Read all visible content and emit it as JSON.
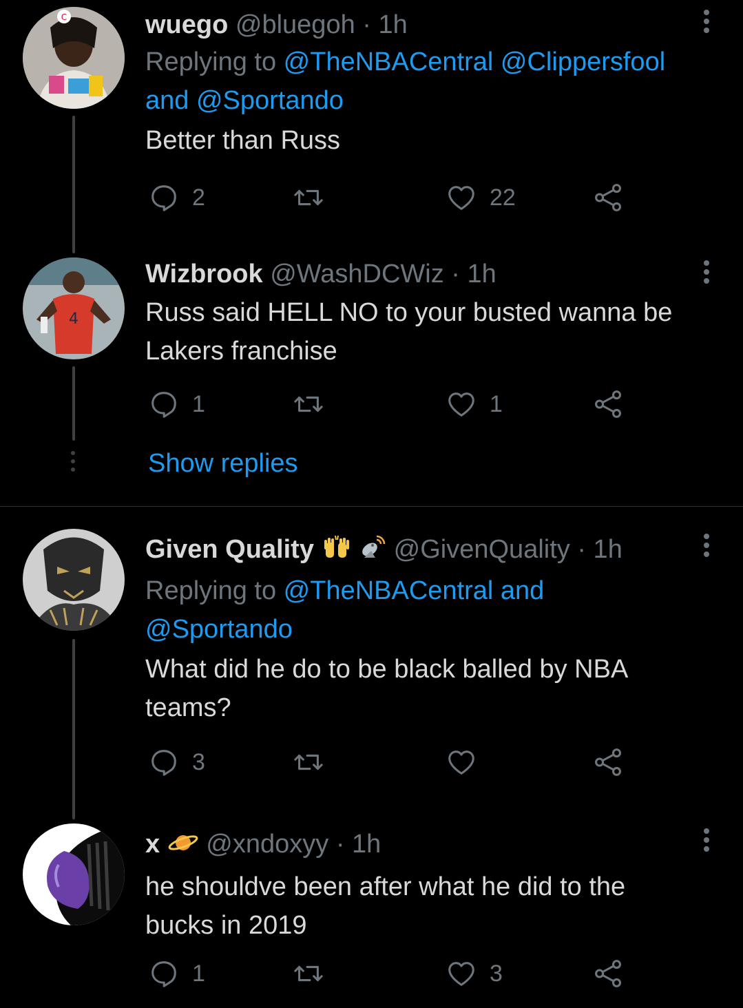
{
  "tweets": [
    {
      "name": "wuego",
      "handle": "@bluegoh",
      "time": "· 1h",
      "replying_prefix": "Replying to ",
      "replying_line1": "@TheNBACentral @Clippersfool",
      "replying_line2_and": "and ",
      "replying_line2_handle": "@Sportando",
      "text": "Better than Russ",
      "replies": "2",
      "retweets": "",
      "likes": "22"
    },
    {
      "name": "Wizbrook",
      "handle": "@WashDCWiz",
      "time": "· 1h",
      "text_line1": "Russ said HELL NO to your busted wanna be",
      "text_line2": "Lakers franchise",
      "replies": "1",
      "retweets": "",
      "likes": "1"
    },
    {
      "name": "Given Quality",
      "name_emojis": [
        "raising-hands-emoji",
        "satellite-dish-emoji"
      ],
      "handle": "@GivenQuality",
      "time": "· 1h",
      "replying_prefix": "Replying to ",
      "replying_line1": "@TheNBACentral and",
      "replying_line2_handle": "@Sportando",
      "text_line1": "What did he do to be black balled by NBA",
      "text_line2": "teams?",
      "replies": "3",
      "retweets": "",
      "likes": ""
    },
    {
      "name": "x",
      "name_emojis": [
        "ringed-planet-emoji"
      ],
      "handle": "@xndoxyy",
      "time": "· 1h",
      "text_line1": "he shouldve been after what he did to the",
      "text_line2": "bucks in 2019",
      "replies": "1",
      "retweets": "",
      "likes": "3"
    }
  ],
  "show_replies": "Show replies",
  "colors": {
    "background": "#000000",
    "text": "#d9d9d9",
    "secondary": "#6e767d",
    "link": "#1d9bf0",
    "thread_line": "#3e4144"
  },
  "icons": [
    "reply-icon",
    "retweet-icon",
    "like-icon",
    "share-icon",
    "more-icon"
  ]
}
